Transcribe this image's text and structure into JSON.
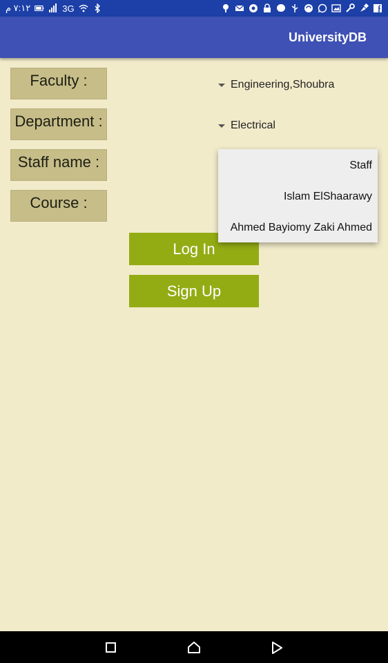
{
  "status_bar": {
    "time": "٧:١٢ م",
    "network": "3G",
    "left_icons": [
      "battery-icon",
      "signal-icon",
      "wifi-icon",
      "bluetooth-icon"
    ],
    "right_icons": [
      "location-pin-icon",
      "mail-icon",
      "chrome-icon",
      "lock-icon",
      "messenger-icon",
      "usb-icon",
      "sync-icon",
      "whatsapp-icon",
      "image-icon",
      "wrench-icon",
      "paint-icon",
      "facebook-icon"
    ]
  },
  "app_bar": {
    "title": "UniversityDB"
  },
  "form": {
    "labels": {
      "faculty": "Faculty :",
      "department": "Department :",
      "staff": "Staff name :",
      "course": "Course :"
    },
    "faculty_value": "Engineering,Shoubra",
    "department_value": "Electrical"
  },
  "staff_dropdown": {
    "options": [
      "Staff",
      "Islam ElShaarawy",
      "Ahmed Bayiomy Zaki Ahmed"
    ]
  },
  "buttons": {
    "login": "Log In",
    "signup": "Sign Up"
  },
  "colors": {
    "background": "#f2ebca",
    "app_bar": "#3f51b5",
    "status_bar": "#1c3fa8",
    "label_box": "#c6bd89",
    "button": "#94ac14",
    "popup": "#eeeeee"
  },
  "nav_bar": {
    "icons": [
      "recents-icon",
      "home-icon",
      "back-icon"
    ]
  }
}
